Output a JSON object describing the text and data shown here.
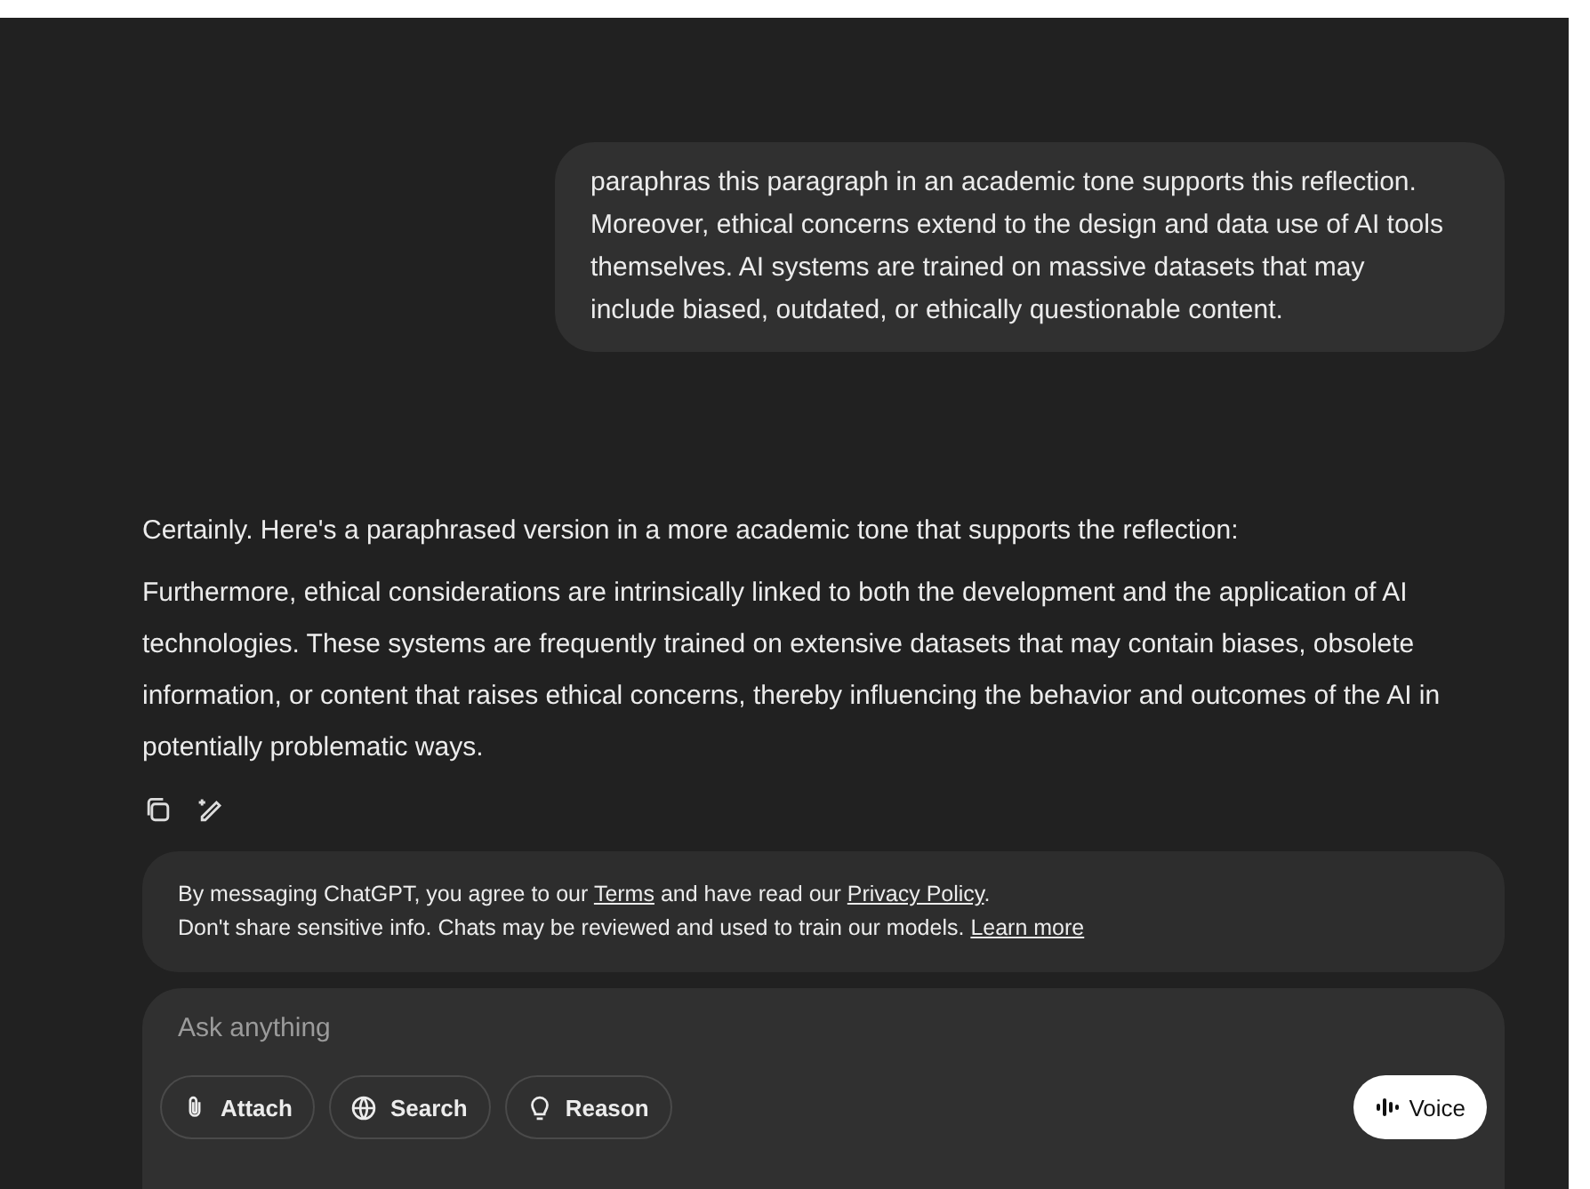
{
  "user_message": "paraphras this paragraph in an academic tone supports this reflection. Moreover, ethical concerns extend to the design and data use of AI tools themselves. AI systems are trained on massive datasets that may include biased, outdated, or ethically questionable content.",
  "assistant_message": {
    "paragraphs": [
      "Certainly. Here's a paraphrased version in a more academic tone that supports the reflection:",
      "Furthermore, ethical considerations are intrinsically linked to both the development and the application of AI technologies. These systems are frequently trained on extensive datasets that may contain biases, obsolete information, or content that raises ethical concerns, thereby influencing the behavior and outcomes of the AI in potentially problematic ways."
    ],
    "actions": [
      {
        "kind": "copy"
      },
      {
        "kind": "edit"
      }
    ]
  },
  "disclaimer": {
    "lines": [
      [
        {
          "text": "By messaging ChatGPT, you agree to our ",
          "link": false
        },
        {
          "text": "Terms",
          "link": true
        },
        {
          "text": " and have read our ",
          "link": false
        },
        {
          "text": "Privacy Policy",
          "link": true
        },
        {
          "text": ".",
          "link": false
        }
      ],
      [
        {
          "text": "Don't share sensitive info. Chats may be reviewed and used to train our models. ",
          "link": false
        },
        {
          "text": "Learn more",
          "link": true
        }
      ]
    ]
  },
  "composer": {
    "placeholder": "Ask anything",
    "tools": [
      {
        "kind": "attach",
        "label": "Attach"
      },
      {
        "kind": "search",
        "label": "Search"
      },
      {
        "kind": "reason",
        "label": "Reason"
      }
    ],
    "voice_button": "Voice"
  }
}
